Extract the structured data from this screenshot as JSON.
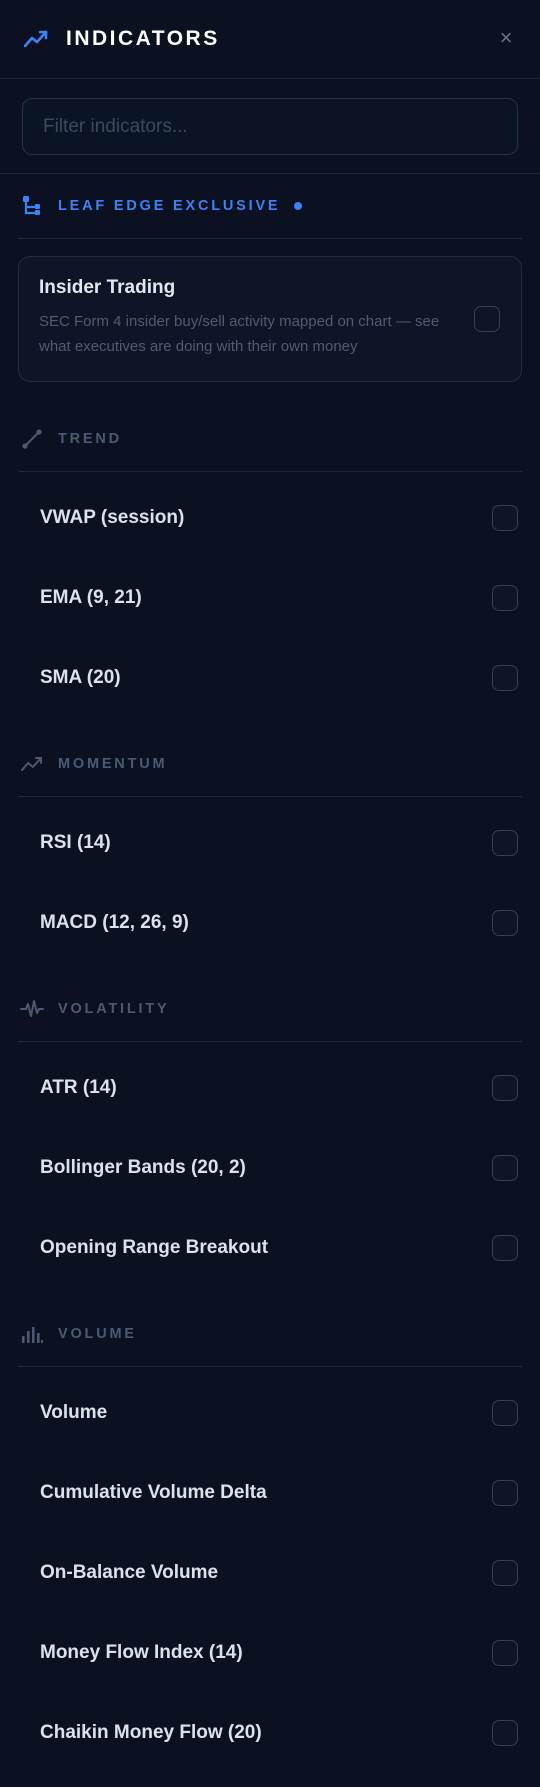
{
  "header": {
    "title": "INDICATORS",
    "title_icon": "trend-line-icon",
    "close_label": "×"
  },
  "search": {
    "placeholder": "Filter indicators...",
    "value": ""
  },
  "exclusive": {
    "label": "LEAF EDGE EXCLUSIVE",
    "icon": "hierarchy-icon",
    "accent": "#3b82f6",
    "items": [
      {
        "title": "Insider Trading",
        "description": "SEC Form 4 insider buy/sell activity mapped on chart — see what executives are doing with their own money",
        "checked": false
      }
    ]
  },
  "sections": [
    {
      "label": "TREND",
      "icon": "diagonal-line-icon",
      "items": [
        {
          "label": "VWAP (session)",
          "checked": false
        },
        {
          "label": "EMA (9, 21)",
          "checked": false
        },
        {
          "label": "SMA (20)",
          "checked": false
        }
      ]
    },
    {
      "label": "MOMENTUM",
      "icon": "trend-line-icon",
      "items": [
        {
          "label": "RSI (14)",
          "checked": false
        },
        {
          "label": "MACD (12, 26, 9)",
          "checked": false
        }
      ]
    },
    {
      "label": "VOLATILITY",
      "icon": "pulse-icon",
      "items": [
        {
          "label": "ATR (14)",
          "checked": false
        },
        {
          "label": "Bollinger Bands (20, 2)",
          "checked": false
        },
        {
          "label": "Opening Range Breakout",
          "checked": false
        }
      ]
    },
    {
      "label": "VOLUME",
      "icon": "bar-chart-icon",
      "items": [
        {
          "label": "Volume",
          "checked": false
        },
        {
          "label": "Cumulative Volume Delta",
          "checked": false
        },
        {
          "label": "On-Balance Volume",
          "checked": false
        },
        {
          "label": "Money Flow Index (14)",
          "checked": false
        },
        {
          "label": "Chaikin Money Flow (20)",
          "checked": false
        }
      ]
    }
  ]
}
